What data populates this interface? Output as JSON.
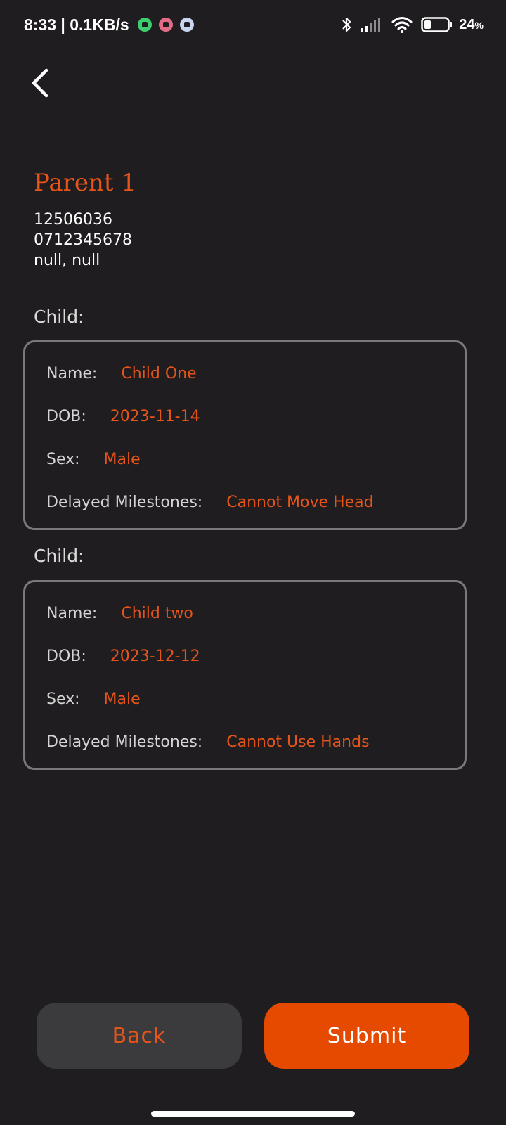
{
  "status_bar": {
    "time_speed": "8:33 | 0.1KB/s",
    "battery": "24",
    "battery_unit": "%"
  },
  "parent": {
    "title": "Parent 1",
    "id": "12506036",
    "phone": "0712345678",
    "location": "null, null"
  },
  "children": [
    {
      "section_label": "Child:",
      "name_label": "Name:",
      "name": "Child One",
      "dob_label": "DOB:",
      "dob": "2023-11-14",
      "sex_label": "Sex:",
      "sex": "Male",
      "milestones_label": "Delayed Milestones:",
      "milestones": "Cannot Move Head"
    },
    {
      "section_label": "Child:",
      "name_label": "Name:",
      "name": "Child two",
      "dob_label": "DOB:",
      "dob": "2023-12-12",
      "sex_label": "Sex:",
      "sex": "Male",
      "milestones_label": "Delayed Milestones:",
      "milestones": "Cannot Use Hands"
    }
  ],
  "buttons": {
    "back": "Back",
    "submit": "Submit"
  },
  "colors": {
    "accent": "#e5551a",
    "submit_bg": "#e64a00",
    "back_bg": "#3b3a3d",
    "background": "#1f1d1f"
  }
}
